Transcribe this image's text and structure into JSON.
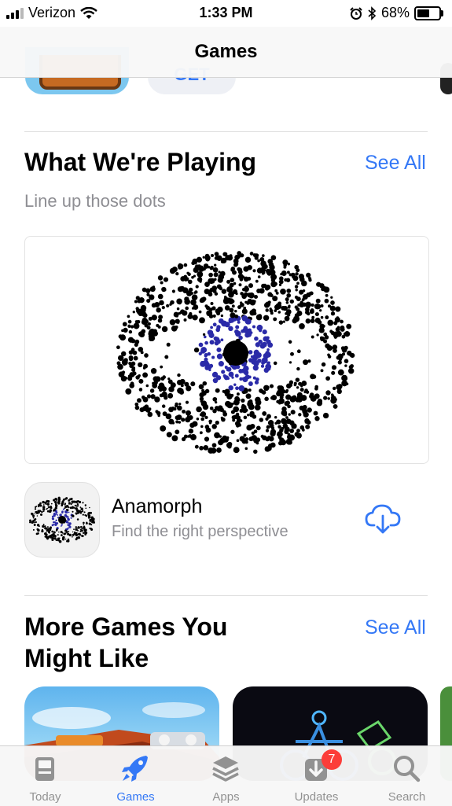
{
  "status_bar": {
    "carrier": "Verizon",
    "time": "1:33 PM",
    "battery": "68%",
    "battery_level": 0.68,
    "icons": [
      "signal-icon",
      "wifi-icon",
      "alarm-icon",
      "bluetooth-icon",
      "battery-icon"
    ]
  },
  "nav": {
    "title": "Games"
  },
  "previous_section": {
    "button_label": "GET"
  },
  "section_playing": {
    "title": "What We're Playing",
    "see_all": "See All",
    "subtitle": "Line up those dots"
  },
  "featured_app": {
    "name": "Anamorph",
    "description": "Find the right perspective",
    "action_icon": "cloud-download-icon"
  },
  "section_more": {
    "title_line1": "More Games You",
    "title_line2": "Might Like",
    "see_all": "See All"
  },
  "tab_bar": {
    "tabs": [
      {
        "label": "Today",
        "icon": "today-icon",
        "active": false
      },
      {
        "label": "Games",
        "icon": "rocket-icon",
        "active": true
      },
      {
        "label": "Apps",
        "icon": "layers-icon",
        "active": false
      },
      {
        "label": "Updates",
        "icon": "updates-icon",
        "active": false,
        "badge": "7"
      },
      {
        "label": "Search",
        "icon": "search-icon",
        "active": false
      }
    ]
  },
  "colors": {
    "accent": "#3478f6",
    "badge": "#fc3d39",
    "secondary_text": "#8e8e93",
    "eye_iris": "#2a2aa8"
  }
}
